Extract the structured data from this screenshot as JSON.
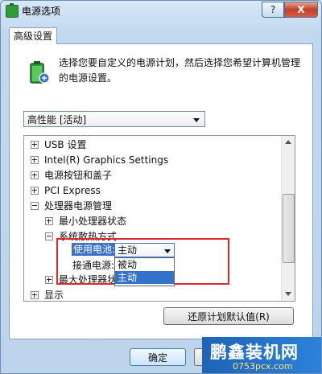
{
  "window": {
    "title": "电源选项",
    "help_label": "?",
    "close_label": "X"
  },
  "tab": {
    "label": "高级设置"
  },
  "description": "选择您要自定义的电源计划，然后选择您希望计算机管理的电源设置。",
  "plan_select": {
    "value": "高性能 [活动]"
  },
  "tree": {
    "items": [
      {
        "label": "USB 设置"
      },
      {
        "label": "Intel(R) Graphics Settings"
      },
      {
        "label": "电源按钮和盖子"
      },
      {
        "label": "PCI Express"
      },
      {
        "label": "处理器电源管理"
      },
      {
        "label": "最小处理器状态"
      },
      {
        "label": "系统散热方式"
      },
      {
        "label": "使用电池:"
      },
      {
        "label": "接通电源:"
      },
      {
        "label": "最大处理器状态"
      },
      {
        "label": "显示"
      }
    ],
    "battery_select_value": "主动",
    "dropdown_options": [
      "被动",
      "主动"
    ]
  },
  "buttons": {
    "restore_defaults": "还原计划默认值(R)",
    "ok": "确定"
  },
  "watermark": {
    "title": "鹏鑫装机网",
    "url": "0753pcx.com"
  },
  "colors": {
    "highlight": "#3373cc",
    "annotation_border": "#e0262e"
  }
}
